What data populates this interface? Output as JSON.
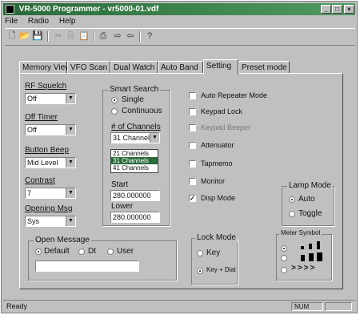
{
  "window": {
    "title": "VR-5000 Programmer - vr5000-01.vdf",
    "close_glyph": "×",
    "min_glyph": "_",
    "max_glyph": "□"
  },
  "menu": [
    "File",
    "Radio",
    "Help"
  ],
  "toolbar": {
    "icons": [
      "new-file-icon",
      "open-folder-icon",
      "save-icon",
      "cut-icon",
      "copy-icon",
      "paste-icon",
      "print-icon",
      "upload-icon",
      "download-icon",
      "help-icon"
    ]
  },
  "tabs": [
    "Memory View",
    "VFO Scan",
    "Dual Watch",
    "Auto Band",
    "Setting",
    "Preset mode"
  ],
  "active_tab": "Setting",
  "settings": {
    "rf_squelch": {
      "label": "RF Squelch",
      "value": "Off"
    },
    "off_timer": {
      "label": "Off Timer",
      "value": "Off"
    },
    "button_beep": {
      "label": "Button Beep",
      "value": "Mid Level"
    },
    "contrast": {
      "label": "Contrast",
      "value": "7"
    },
    "opening_msg": {
      "label": "Opening Msg",
      "value": "Sys"
    }
  },
  "smart_search": {
    "label": "Smart Search",
    "options": [
      "Single",
      "Continuous"
    ],
    "selected": "Single",
    "num_channels_label": "# of Channels",
    "num_channels_value": "31 Channels",
    "channel_options": [
      "21 Channels",
      "31 Channels",
      "41 Channels"
    ],
    "start_label": "Start",
    "start_value": "280.000000",
    "lower_label": "Lower",
    "lower_value": "280.000000"
  },
  "checkboxes": [
    {
      "label": "Auto Repeater Mode",
      "checked": false,
      "enabled": true
    },
    {
      "label": "Keypad Lock",
      "checked": false,
      "enabled": true
    },
    {
      "label": "Keypad Beeper",
      "checked": false,
      "enabled": false
    },
    {
      "label": "Attenuator",
      "checked": false,
      "enabled": true
    },
    {
      "label": "Tapmemo",
      "checked": false,
      "enabled": true
    },
    {
      "label": "Monitor",
      "checked": false,
      "enabled": true
    },
    {
      "label": "Disp Mode",
      "checked": true,
      "enabled": true
    }
  ],
  "lamp_mode": {
    "label": "Lamp Mode",
    "options": [
      "Auto",
      "Toggle"
    ],
    "selected": "Auto"
  },
  "open_message": {
    "label": "Open Message",
    "options": [
      "Default",
      "Dt",
      "User"
    ],
    "selected": "Default",
    "text": ""
  },
  "lock_mode": {
    "label": "Lock Mode",
    "options": [
      "Key",
      "Key + Dial"
    ],
    "selected": "Key + Dial"
  },
  "meter_symbol": {
    "label": "Meter Symbol"
  },
  "status": {
    "left": "Ready",
    "right": "NUM"
  }
}
